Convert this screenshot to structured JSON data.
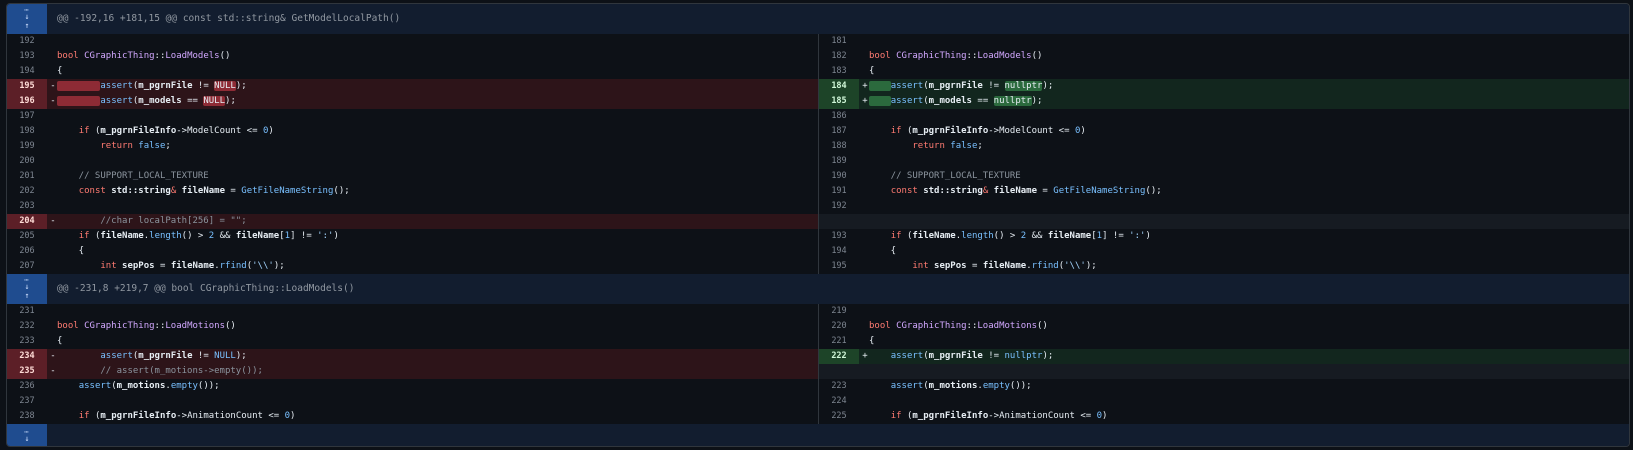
{
  "expander_icons": {
    "up": "expand-up-icon",
    "down": "expand-down-icon",
    "dots": "⋯"
  },
  "hunks": [
    {
      "header": "@@ -192,16 +181,15 @@ const std::string& GetModelLocalPath()",
      "rows": [
        {
          "lnum": "192",
          "ltype": "ctx",
          "lcode": [],
          "rnum": "181",
          "rtype": "ctx",
          "rcode": []
        },
        {
          "lnum": "193",
          "ltype": "ctx",
          "lcode": [
            [
              "kw",
              "bool "
            ],
            [
              "fn",
              "CGraphicThing"
            ],
            [
              "",
              "::"
            ],
            [
              "fn",
              "LoadModels"
            ],
            [
              "",
              "()"
            ]
          ],
          "rnum": "182",
          "rtype": "ctx",
          "rcode": [
            [
              "kw",
              "bool "
            ],
            [
              "fn",
              "CGraphicThing"
            ],
            [
              "",
              "::"
            ],
            [
              "fn",
              "LoadModels"
            ],
            [
              "",
              "()"
            ]
          ]
        },
        {
          "lnum": "194",
          "ltype": "ctx",
          "lcode": [
            [
              "",
              "{"
            ]
          ],
          "rnum": "183",
          "rtype": "ctx",
          "rcode": [
            [
              "",
              "{"
            ]
          ]
        },
        {
          "lnum": "195",
          "ltype": "del",
          "lcode": [
            [
              "hl-del",
              "        "
            ],
            [
              "call",
              "assert"
            ],
            [
              "",
              "("
            ],
            [
              "bold",
              "m_pgrnFile"
            ],
            [
              "",
              " != "
            ],
            [
              "hl-del",
              "NULL"
            ],
            [
              "",
              ");"
            ]
          ],
          "rnum": "184",
          "rtype": "add",
          "rcode": [
            [
              "hl-add",
              "    "
            ],
            [
              "call",
              "assert"
            ],
            [
              "",
              "("
            ],
            [
              "bold",
              "m_pgrnFile"
            ],
            [
              "",
              " != "
            ],
            [
              "hl-add",
              "nullptr"
            ],
            [
              "",
              ");"
            ]
          ]
        },
        {
          "lnum": "196",
          "ltype": "del",
          "lcode": [
            [
              "hl-del",
              "        "
            ],
            [
              "call",
              "assert"
            ],
            [
              "",
              "("
            ],
            [
              "bold",
              "m_models"
            ],
            [
              "",
              " == "
            ],
            [
              "hl-del",
              "NULL"
            ],
            [
              "",
              ");"
            ]
          ],
          "rnum": "185",
          "rtype": "add",
          "rcode": [
            [
              "hl-add",
              "    "
            ],
            [
              "call",
              "assert"
            ],
            [
              "",
              "("
            ],
            [
              "bold",
              "m_models"
            ],
            [
              "",
              " == "
            ],
            [
              "hl-add",
              "nullptr"
            ],
            [
              "",
              ");"
            ]
          ]
        },
        {
          "lnum": "197",
          "ltype": "ctx",
          "lcode": [],
          "rnum": "186",
          "rtype": "ctx",
          "rcode": []
        },
        {
          "lnum": "198",
          "ltype": "ctx",
          "lcode": [
            [
              "",
              "    "
            ],
            [
              "kw",
              "if "
            ],
            [
              "",
              "("
            ],
            [
              "bold",
              "m_pgrnFileInfo"
            ],
            [
              "",
              "->ModelCount <= "
            ],
            [
              "num-lit",
              "0"
            ],
            [
              "",
              ")"
            ]
          ],
          "rnum": "187",
          "rtype": "ctx",
          "rcode": [
            [
              "",
              "    "
            ],
            [
              "kw",
              "if "
            ],
            [
              "",
              "("
            ],
            [
              "bold",
              "m_pgrnFileInfo"
            ],
            [
              "",
              "->ModelCount <= "
            ],
            [
              "num-lit",
              "0"
            ],
            [
              "",
              ")"
            ]
          ]
        },
        {
          "lnum": "199",
          "ltype": "ctx",
          "lcode": [
            [
              "",
              "        "
            ],
            [
              "kw",
              "return "
            ],
            [
              "call",
              "false"
            ],
            [
              "",
              ";"
            ]
          ],
          "rnum": "188",
          "rtype": "ctx",
          "rcode": [
            [
              "",
              "        "
            ],
            [
              "kw",
              "return "
            ],
            [
              "call",
              "false"
            ],
            [
              "",
              ";"
            ]
          ]
        },
        {
          "lnum": "200",
          "ltype": "ctx",
          "lcode": [],
          "rnum": "189",
          "rtype": "ctx",
          "rcode": []
        },
        {
          "lnum": "201",
          "ltype": "ctx",
          "lcode": [
            [
              "cm",
              "    // SUPPORT_LOCAL_TEXTURE"
            ]
          ],
          "rnum": "190",
          "rtype": "ctx",
          "rcode": [
            [
              "cm",
              "    // SUPPORT_LOCAL_TEXTURE"
            ]
          ]
        },
        {
          "lnum": "202",
          "ltype": "ctx",
          "lcode": [
            [
              "",
              "    "
            ],
            [
              "kw",
              "const "
            ],
            [
              "bold",
              "std::string"
            ],
            [
              "kw",
              "& "
            ],
            [
              "bold",
              "fileName"
            ],
            [
              "",
              " = "
            ],
            [
              "call",
              "GetFileNameString"
            ],
            [
              "",
              "();"
            ]
          ],
          "rnum": "191",
          "rtype": "ctx",
          "rcode": [
            [
              "",
              "    "
            ],
            [
              "kw",
              "const "
            ],
            [
              "bold",
              "std::string"
            ],
            [
              "kw",
              "& "
            ],
            [
              "bold",
              "fileName"
            ],
            [
              "",
              " = "
            ],
            [
              "call",
              "GetFileNameString"
            ],
            [
              "",
              "();"
            ]
          ]
        },
        {
          "lnum": "203",
          "ltype": "ctx",
          "lcode": [],
          "rnum": "192",
          "rtype": "ctx",
          "rcode": []
        },
        {
          "lnum": "204",
          "ltype": "del",
          "lcode": [
            [
              "cm",
              "        //char localPath[256] = \"\";"
            ]
          ],
          "rnum": "",
          "rtype": "empty",
          "rcode": []
        },
        {
          "lnum": "205",
          "ltype": "ctx",
          "lcode": [
            [
              "",
              "    "
            ],
            [
              "kw",
              "if "
            ],
            [
              "",
              "("
            ],
            [
              "bold",
              "fileName"
            ],
            [
              "",
              "."
            ],
            [
              "call",
              "length"
            ],
            [
              "",
              "() > "
            ],
            [
              "num-lit",
              "2"
            ],
            [
              "",
              " && "
            ],
            [
              "bold",
              "fileName"
            ],
            [
              "",
              "["
            ],
            [
              "num-lit",
              "1"
            ],
            [
              "",
              "] != "
            ],
            [
              "str",
              "':'"
            ],
            [
              "",
              ")"
            ]
          ],
          "rnum": "193",
          "rtype": "ctx",
          "rcode": [
            [
              "",
              "    "
            ],
            [
              "kw",
              "if "
            ],
            [
              "",
              "("
            ],
            [
              "bold",
              "fileName"
            ],
            [
              "",
              "."
            ],
            [
              "call",
              "length"
            ],
            [
              "",
              "() > "
            ],
            [
              "num-lit",
              "2"
            ],
            [
              "",
              " && "
            ],
            [
              "bold",
              "fileName"
            ],
            [
              "",
              "["
            ],
            [
              "num-lit",
              "1"
            ],
            [
              "",
              "] != "
            ],
            [
              "str",
              "':'"
            ],
            [
              "",
              ")"
            ]
          ]
        },
        {
          "lnum": "206",
          "ltype": "ctx",
          "lcode": [
            [
              "",
              "    {"
            ]
          ],
          "rnum": "194",
          "rtype": "ctx",
          "rcode": [
            [
              "",
              "    {"
            ]
          ]
        },
        {
          "lnum": "207",
          "ltype": "ctx",
          "lcode": [
            [
              "",
              "        "
            ],
            [
              "kw",
              "int "
            ],
            [
              "bold",
              "sepPos"
            ],
            [
              "",
              " = "
            ],
            [
              "bold",
              "fileName"
            ],
            [
              "",
              "."
            ],
            [
              "call",
              "rfind"
            ],
            [
              "",
              "("
            ],
            [
              "str",
              "'\\\\'"
            ],
            [
              "",
              ");"
            ]
          ],
          "rnum": "195",
          "rtype": "ctx",
          "rcode": [
            [
              "",
              "        "
            ],
            [
              "kw",
              "int "
            ],
            [
              "bold",
              "sepPos"
            ],
            [
              "",
              " = "
            ],
            [
              "bold",
              "fileName"
            ],
            [
              "",
              "."
            ],
            [
              "call",
              "rfind"
            ],
            [
              "",
              "("
            ],
            [
              "str",
              "'\\\\'"
            ],
            [
              "",
              ");"
            ]
          ]
        }
      ]
    },
    {
      "header": "@@ -231,8 +219,7 @@ bool CGraphicThing::LoadModels()",
      "rows": [
        {
          "lnum": "231",
          "ltype": "ctx",
          "lcode": [],
          "rnum": "219",
          "rtype": "ctx",
          "rcode": []
        },
        {
          "lnum": "232",
          "ltype": "ctx",
          "lcode": [
            [
              "kw",
              "bool "
            ],
            [
              "fn",
              "CGraphicThing"
            ],
            [
              "",
              "::"
            ],
            [
              "fn",
              "LoadMotions"
            ],
            [
              "",
              "()"
            ]
          ],
          "rnum": "220",
          "rtype": "ctx",
          "rcode": [
            [
              "kw",
              "bool "
            ],
            [
              "fn",
              "CGraphicThing"
            ],
            [
              "",
              "::"
            ],
            [
              "fn",
              "LoadMotions"
            ],
            [
              "",
              "()"
            ]
          ]
        },
        {
          "lnum": "233",
          "ltype": "ctx",
          "lcode": [
            [
              "",
              "{"
            ]
          ],
          "rnum": "221",
          "rtype": "ctx",
          "rcode": [
            [
              "",
              "{"
            ]
          ]
        },
        {
          "lnum": "234",
          "ltype": "del",
          "lcode": [
            [
              "",
              "        "
            ],
            [
              "call",
              "assert"
            ],
            [
              "",
              "("
            ],
            [
              "bold",
              "m_pgrnFile"
            ],
            [
              "",
              " != "
            ],
            [
              "call",
              "NULL"
            ],
            [
              "",
              ");"
            ]
          ],
          "rnum": "222",
          "rtype": "add",
          "rcode": [
            [
              "",
              "    "
            ],
            [
              "call",
              "assert"
            ],
            [
              "",
              "("
            ],
            [
              "bold",
              "m_pgrnFile"
            ],
            [
              "",
              " != "
            ],
            [
              "call",
              "nullptr"
            ],
            [
              "",
              ");"
            ]
          ]
        },
        {
          "lnum": "235",
          "ltype": "del",
          "lcode": [
            [
              "cm",
              "        // assert(m_motions->empty());"
            ]
          ],
          "rnum": "",
          "rtype": "empty",
          "rcode": []
        },
        {
          "lnum": "236",
          "ltype": "ctx",
          "lcode": [
            [
              "",
              "    "
            ],
            [
              "call",
              "assert"
            ],
            [
              "",
              "("
            ],
            [
              "bold",
              "m_motions"
            ],
            [
              "",
              "."
            ],
            [
              "call",
              "empty"
            ],
            [
              "",
              "());"
            ]
          ],
          "rnum": "223",
          "rtype": "ctx",
          "rcode": [
            [
              "",
              "    "
            ],
            [
              "call",
              "assert"
            ],
            [
              "",
              "("
            ],
            [
              "bold",
              "m_motions"
            ],
            [
              "",
              "."
            ],
            [
              "call",
              "empty"
            ],
            [
              "",
              "());"
            ]
          ]
        },
        {
          "lnum": "237",
          "ltype": "ctx",
          "lcode": [],
          "rnum": "224",
          "rtype": "ctx",
          "rcode": []
        },
        {
          "lnum": "238",
          "ltype": "ctx",
          "lcode": [
            [
              "",
              "    "
            ],
            [
              "kw",
              "if "
            ],
            [
              "",
              "("
            ],
            [
              "bold",
              "m_pgrnFileInfo"
            ],
            [
              "",
              "->AnimationCount <= "
            ],
            [
              "num-lit",
              "0"
            ],
            [
              "",
              ")"
            ]
          ],
          "rnum": "225",
          "rtype": "ctx",
          "rcode": [
            [
              "",
              "    "
            ],
            [
              "kw",
              "if "
            ],
            [
              "",
              "("
            ],
            [
              "bold",
              "m_pgrnFileInfo"
            ],
            [
              "",
              "->AnimationCount <= "
            ],
            [
              "num-lit",
              "0"
            ],
            [
              "",
              ")"
            ]
          ]
        }
      ]
    }
  ],
  "markers": {
    "del": "-",
    "add": "+"
  }
}
